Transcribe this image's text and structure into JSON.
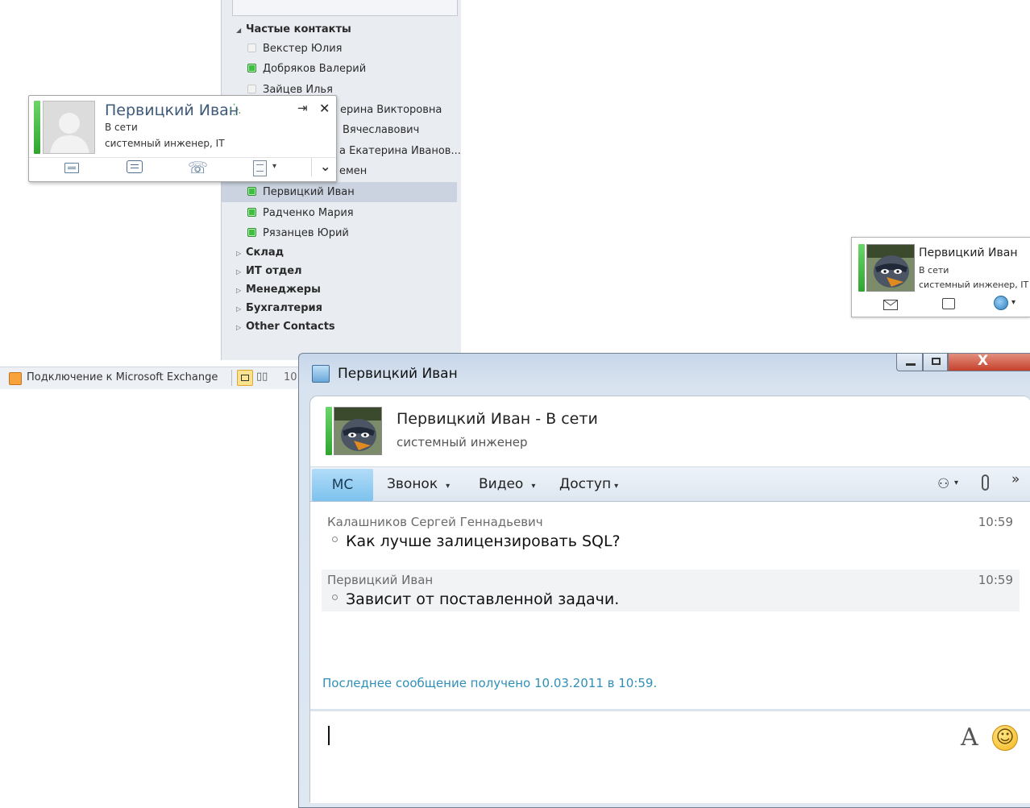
{
  "contact_list": {
    "groups": [
      {
        "label": "Частые контакты",
        "expanded": true,
        "contacts": [
          {
            "name": "Векстер Юлия",
            "status": "offline"
          },
          {
            "name": "Добряков Валерий",
            "status": "online"
          },
          {
            "name": "Зайцев Илья",
            "status": "offline"
          },
          {
            "name": "ерина Викторовна",
            "status": "hidden"
          },
          {
            "name": "Вячеславович",
            "status": "hidden"
          },
          {
            "name": "а Екатерина Иванов...",
            "status": "hidden"
          },
          {
            "name": "емен",
            "status": "hidden"
          },
          {
            "name": "Первицкий Иван",
            "status": "online",
            "selected": true
          },
          {
            "name": "Радченко Мария",
            "status": "online"
          },
          {
            "name": "Рязанцев Юрий",
            "status": "online"
          }
        ]
      },
      {
        "label": "Склад",
        "expanded": false
      },
      {
        "label": "ИТ отдел",
        "expanded": false
      },
      {
        "label": "Менеджеры",
        "expanded": false
      },
      {
        "label": "Бухгалтерия",
        "expanded": false
      },
      {
        "label": "Other Contacts",
        "expanded": false
      }
    ]
  },
  "statusbar": {
    "exchange_label": "Подключение к Microsoft Exchange",
    "zoom_partial": "10"
  },
  "contact_card": {
    "name": "Первицкий Иван",
    "status": "В сети",
    "title": "системный инженер, IT",
    "pin_glyph": "⇥",
    "close_glyph": "✕",
    "chevron_glyph": "⌄",
    "dropdown_glyph": "▾"
  },
  "mini_card": {
    "name": "Первицкий Иван",
    "status": "В сети",
    "title": "системный инженер, IT",
    "dropdown_glyph": "▾"
  },
  "im_window": {
    "title": "Первицкий Иван",
    "header_name": "Первицкий Иван",
    "header_status": "- В сети",
    "header_title": "системный инженер",
    "toolbar": {
      "im_tab": "МС",
      "call": "Звонок",
      "video": "Видео",
      "share": "Доступ",
      "more": "»",
      "caret": "▾"
    },
    "messages": [
      {
        "sender": "Калашников Сергей Геннадьевич",
        "time": "10:59",
        "text": "Как лучше залицензировать SQL?"
      },
      {
        "sender": "Первицкий Иван",
        "time": "10:59",
        "text": "Зависит от поставленной задачи."
      }
    ],
    "last_received": "Последнее сообщение получено 10.03.2011 в 10:59.",
    "font_button": "A",
    "emoticon_glyph": "☺"
  },
  "colors": {
    "presence_online": "#3fbf3f",
    "link_blue": "#2f8fb9",
    "selected_row": "#cbd3e0",
    "im_tab": "#7cc2ee"
  }
}
